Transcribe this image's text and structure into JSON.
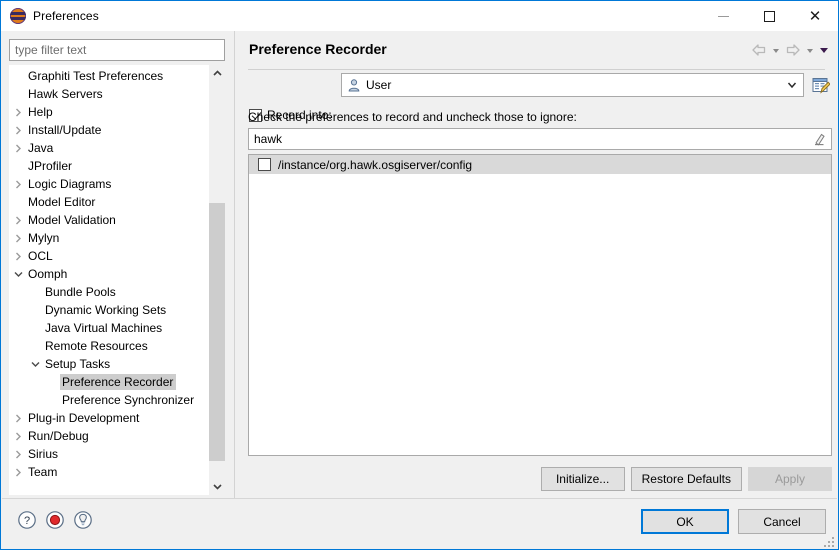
{
  "window": {
    "title": "Preferences",
    "icon": "eclipse-globe-icon",
    "minimize_label": "Minimize",
    "maximize_label": "Maximize",
    "close_label": "Close"
  },
  "sidebar": {
    "filter_placeholder": "type filter text",
    "filter_value": "",
    "items": [
      {
        "label": "Graphiti Test Preferences",
        "indent": 1,
        "twisty": "none",
        "selected": false
      },
      {
        "label": "Hawk Servers",
        "indent": 1,
        "twisty": "none",
        "selected": false
      },
      {
        "label": "Help",
        "indent": 1,
        "twisty": "collapsed",
        "selected": false
      },
      {
        "label": "Install/Update",
        "indent": 1,
        "twisty": "collapsed",
        "selected": false
      },
      {
        "label": "Java",
        "indent": 1,
        "twisty": "collapsed",
        "selected": false
      },
      {
        "label": "JProfiler",
        "indent": 1,
        "twisty": "none",
        "selected": false
      },
      {
        "label": "Logic Diagrams",
        "indent": 1,
        "twisty": "collapsed",
        "selected": false
      },
      {
        "label": "Model Editor",
        "indent": 1,
        "twisty": "none",
        "selected": false
      },
      {
        "label": "Model Validation",
        "indent": 1,
        "twisty": "collapsed",
        "selected": false
      },
      {
        "label": "Mylyn",
        "indent": 1,
        "twisty": "collapsed",
        "selected": false
      },
      {
        "label": "OCL",
        "indent": 1,
        "twisty": "collapsed",
        "selected": false
      },
      {
        "label": "Oomph",
        "indent": 1,
        "twisty": "expanded",
        "selected": false
      },
      {
        "label": "Bundle Pools",
        "indent": 2,
        "twisty": "none",
        "selected": false
      },
      {
        "label": "Dynamic Working Sets",
        "indent": 2,
        "twisty": "none",
        "selected": false
      },
      {
        "label": "Java Virtual Machines",
        "indent": 2,
        "twisty": "none",
        "selected": false
      },
      {
        "label": "Remote Resources",
        "indent": 2,
        "twisty": "none",
        "selected": false
      },
      {
        "label": "Setup Tasks",
        "indent": 2,
        "twisty": "expanded",
        "selected": false
      },
      {
        "label": "Preference Recorder",
        "indent": 3,
        "twisty": "none",
        "selected": true
      },
      {
        "label": "Preference Synchronizer",
        "indent": 3,
        "twisty": "none",
        "selected": false
      },
      {
        "label": "Plug-in Development",
        "indent": 1,
        "twisty": "collapsed",
        "selected": false
      },
      {
        "label": "Run/Debug",
        "indent": 1,
        "twisty": "collapsed",
        "selected": false
      },
      {
        "label": "Sirius",
        "indent": 1,
        "twisty": "collapsed",
        "selected": false
      },
      {
        "label": "Team",
        "indent": 1,
        "twisty": "collapsed",
        "selected": false
      }
    ],
    "scrollbar": {
      "up_icon": "chevron-up-icon",
      "down_icon": "chevron-down-icon"
    }
  },
  "panel": {
    "title": "Preference Recorder",
    "nav": {
      "back_icon": "back-arrow-icon",
      "back_menu_icon": "chevron-down-icon",
      "forward_icon": "forward-arrow-icon",
      "forward_menu_icon": "chevron-down-icon",
      "view_menu_icon": "view-menu-triangle-icon"
    },
    "record_into": {
      "checkbox_label": "Record into:",
      "checked": true,
      "selected_value": "User",
      "value_icon": "user-icon",
      "dropdown_icon": "chevron-down-icon",
      "options": [
        "User"
      ]
    },
    "edit_icon": "preference-recorder-edit-icon",
    "hint": "Check the preferences to record and uncheck those to ignore:",
    "filter": {
      "value": "hawk",
      "clear_icon": "eraser-icon"
    },
    "entries": [
      {
        "label": "/instance/org.hawk.osgiserver/config",
        "checked": false,
        "highlighted": true
      }
    ],
    "buttons": {
      "initialize": "Initialize...",
      "restore_defaults": "Restore Defaults",
      "apply": "Apply",
      "apply_enabled": false
    }
  },
  "bottombar": {
    "icons": [
      {
        "name": "help-icon",
        "glyph": "?"
      },
      {
        "name": "record-icon",
        "glyph": ""
      },
      {
        "name": "lightbulb-icon",
        "glyph": ""
      }
    ],
    "ok": "OK",
    "cancel": "Cancel"
  },
  "colors": {
    "accent": "#0078d7",
    "window_bg": "#f0f0f0",
    "panel_bg": "#f0f0f0",
    "selection": "#cdcdcd",
    "row_highlight": "#d9d9d9",
    "record_red": "#e0292b"
  }
}
